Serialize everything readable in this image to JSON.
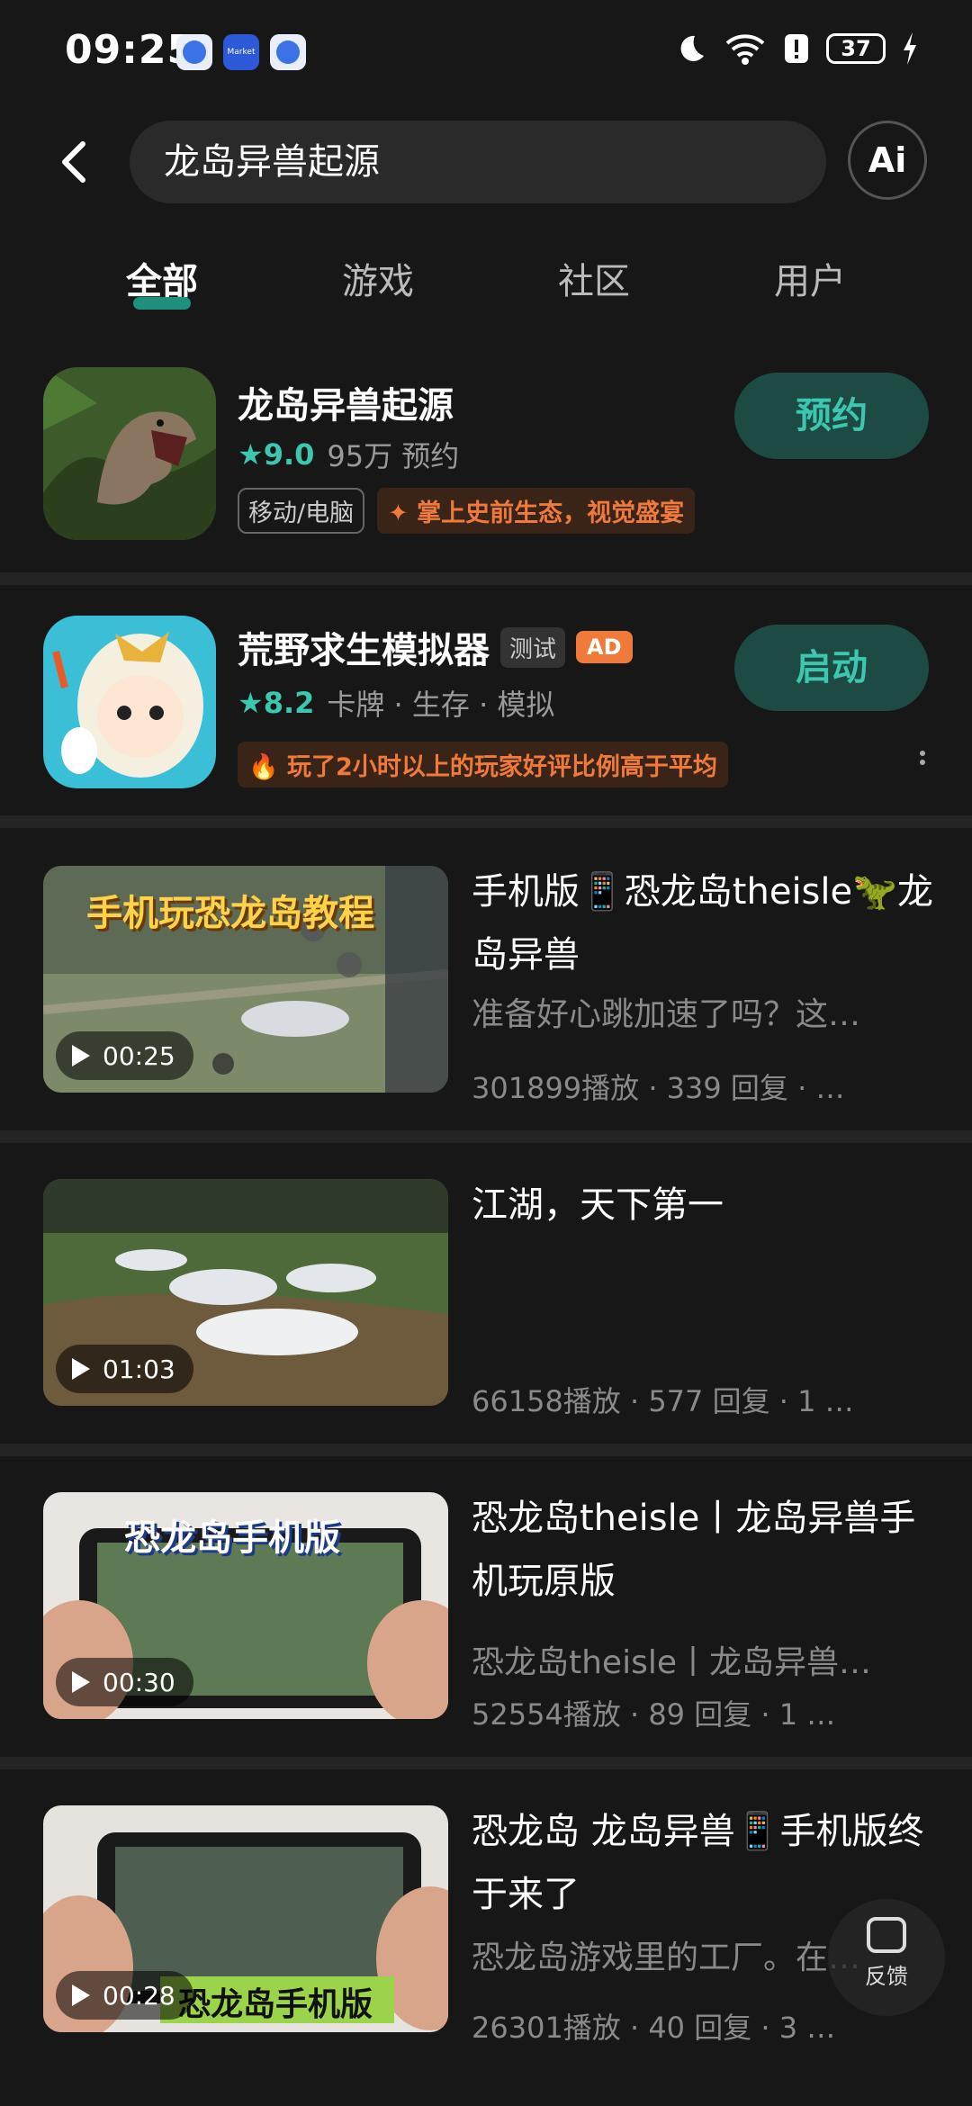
{
  "status_bar": {
    "time": "09:25",
    "battery": "37",
    "market_label": "Market"
  },
  "search": {
    "query": "龙岛异兽起源",
    "ai_label": "Ai"
  },
  "tabs": [
    {
      "label": "全部",
      "active": true
    },
    {
      "label": "游戏",
      "active": false
    },
    {
      "label": "社区",
      "active": false
    },
    {
      "label": "用户",
      "active": false
    }
  ],
  "apps": [
    {
      "name": "龙岛异兽起源",
      "rating": "9.0",
      "meta": "95万 预约",
      "platform_tag": "移动/电脑",
      "promo": "掌上史前生态，视觉盛宴",
      "action": "预约"
    },
    {
      "name": "荒野求生模拟器",
      "badge_test": "测试",
      "badge_ad": "AD",
      "rating": "8.2",
      "meta": "卡牌 · 生存 · 模拟",
      "promo": "玩了2小时以上的玩家好评比例高于平均",
      "action": "启动"
    }
  ],
  "videos": [
    {
      "title": "手机版📱恐龙岛theisle🦖龙岛异兽",
      "desc": "准备好心跳加速了吗？这…",
      "stats": "301899播放 · 339 回复 · …",
      "duration": "00:25",
      "thumb_text": "手机玩恐龙岛教程"
    },
    {
      "title": "江湖，天下第一",
      "desc": "",
      "stats": "66158播放 · 577 回复 · 1 …",
      "duration": "01:03",
      "thumb_text": ""
    },
    {
      "title": "恐龙岛theisle丨龙岛异兽手机玩原版",
      "desc": "恐龙岛theisle丨龙岛异兽…",
      "stats": "52554播放 · 89 回复 · 1 …",
      "duration": "00:30",
      "thumb_text": "恐龙岛手机版"
    },
    {
      "title": "恐龙岛 龙岛异兽📱手机版终于来了",
      "desc": "恐龙岛游戏里的工厂。在…",
      "stats": "26301播放 · 40 回复 · 3 …",
      "duration": "00:28",
      "thumb_text": "恐龙岛手机版"
    }
  ],
  "feedback": {
    "label": "反馈"
  },
  "colors": {
    "accent": "#3cc7b0",
    "accent_bg": "#1e4a44",
    "promo": "#f07a3c",
    "background": "#171717"
  }
}
